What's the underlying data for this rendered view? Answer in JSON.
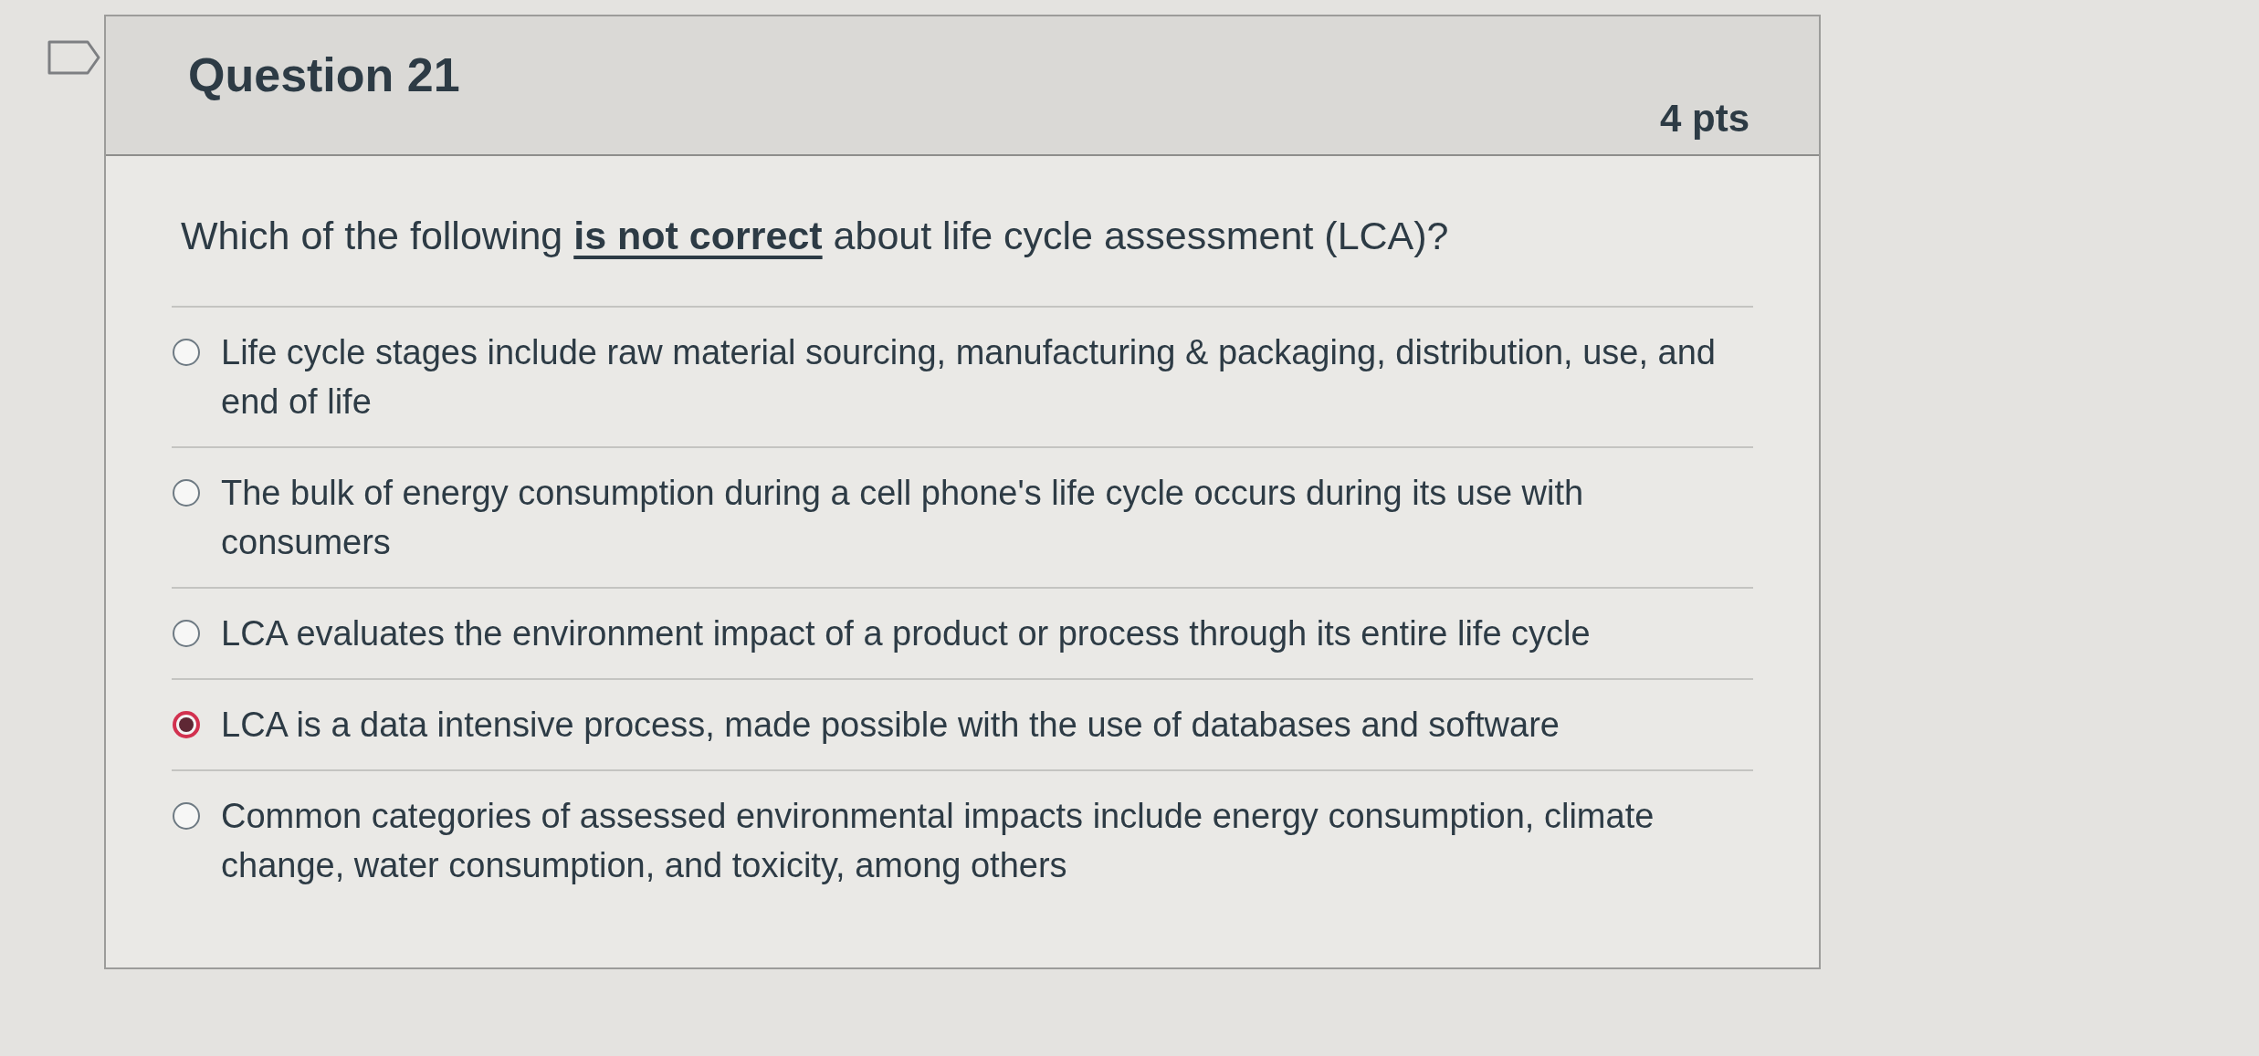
{
  "flag": {
    "flagged": false
  },
  "question": {
    "title": "Question 21",
    "points": "4 pts",
    "prompt": "Which of the following **is not correct** about life cycle assessment (LCA)?"
  },
  "answers": [
    {
      "text": "Life cycle stages include raw material sourcing, manufacturing & packaging, distribution, use, and end of life",
      "selected": false
    },
    {
      "text": "The bulk of energy consumption during a cell phone's life cycle occurs during its use with consumers",
      "selected": false
    },
    {
      "text": "LCA evaluates the environment impact of a product or process through its entire life cycle",
      "selected": false
    },
    {
      "text": "LCA is a data intensive process, made possible with the use of databases and software",
      "selected": true
    },
    {
      "text": "Common categories of assessed environmental impacts include energy consumption, climate change, water consumption, and toxicity, among others",
      "selected": false
    }
  ]
}
